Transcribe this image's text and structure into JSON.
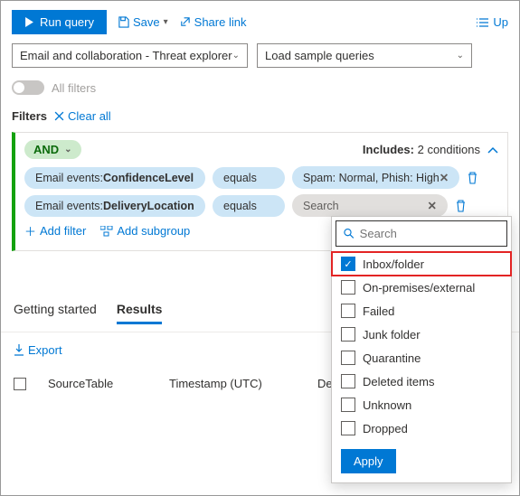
{
  "toolbar": {
    "run_label": "Run query",
    "save_label": "Save",
    "share_label": "Share link",
    "up_label": "Up"
  },
  "scope": {
    "selected": "Email and collaboration - Threat explorer",
    "sample_label": "Load sample queries"
  },
  "filters": {
    "all_filters_label": "All filters",
    "heading": "Filters",
    "clear_all_label": "Clear all"
  },
  "block": {
    "operator": "AND",
    "includes_label": "Includes:",
    "includes_count": "2 conditions",
    "add_filter_label": "Add filter",
    "add_subgroup_label": "Add subgroup",
    "rows": [
      {
        "prop_prefix": "Email events: ",
        "prop": "ConfidenceLevel",
        "op": "equals",
        "val": "Spam: Normal, Phish: High"
      },
      {
        "prop_prefix": "Email events: ",
        "prop": "DeliveryLocation",
        "op": "equals",
        "val": "Search"
      }
    ]
  },
  "dropdown": {
    "search_placeholder": "Search",
    "options": [
      {
        "label": "Inbox/folder",
        "checked": true
      },
      {
        "label": "On-premises/external",
        "checked": false
      },
      {
        "label": "Failed",
        "checked": false
      },
      {
        "label": "Junk folder",
        "checked": false
      },
      {
        "label": "Quarantine",
        "checked": false
      },
      {
        "label": "Deleted items",
        "checked": false
      },
      {
        "label": "Unknown",
        "checked": false
      },
      {
        "label": "Dropped",
        "checked": false
      }
    ],
    "apply_label": "Apply"
  },
  "tabs": {
    "getting_started": "Getting started",
    "results": "Results"
  },
  "results": {
    "export_label": "Export",
    "columns": [
      "SourceTable",
      "Timestamp (UTC)",
      "DeviceId"
    ]
  }
}
